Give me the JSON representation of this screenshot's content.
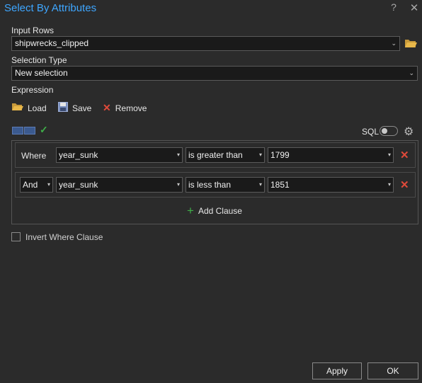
{
  "window": {
    "title": "Select By Attributes",
    "help": "?",
    "close": "✕"
  },
  "input_rows": {
    "label": "Input Rows",
    "value": "shipwrecks_clipped"
  },
  "selection_type": {
    "label": "Selection Type",
    "value": "New selection"
  },
  "expression": {
    "label": "Expression",
    "load": "Load",
    "save": "Save",
    "remove": "Remove",
    "sql_label": "SQL",
    "clauses": [
      {
        "connector": "Where",
        "field": "year_sunk",
        "operator": "is greater than",
        "value": "1799"
      },
      {
        "connector": "And",
        "field": "year_sunk",
        "operator": "is less than",
        "value": "1851"
      }
    ],
    "add_clause": "Add Clause"
  },
  "invert": {
    "label": "Invert Where Clause",
    "checked": false
  },
  "buttons": {
    "apply": "Apply",
    "ok": "OK"
  },
  "icons": {
    "folder": "folder-icon",
    "save": "floppy-disk-icon",
    "remove": "x-icon",
    "verify": "checkmark-icon",
    "settings": "gear-icon"
  },
  "colors": {
    "title": "#3ea6ff",
    "accent_remove": "#e04a3a",
    "check_green": "#3fae49",
    "folder_yellow": "#e8b84a"
  }
}
